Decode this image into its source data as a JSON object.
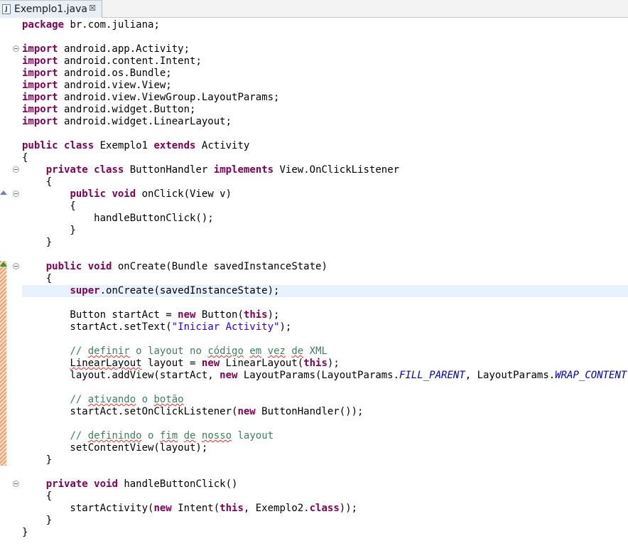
{
  "tab": {
    "title": "Exemplo1.java",
    "close_glyph": "☒",
    "file_icon": "java-file-icon",
    "file_icon_letter": "J"
  },
  "editor": {
    "language": "java",
    "highlighted_line": 23,
    "lines": [
      [
        {
          "t": "package",
          "c": "kw"
        },
        {
          "t": " br.com.juliana;"
        }
      ],
      [],
      [
        {
          "t": "import",
          "c": "kw"
        },
        {
          "t": " android.app.Activity;"
        }
      ],
      [
        {
          "t": "import",
          "c": "kw"
        },
        {
          "t": " android.content.Intent;"
        }
      ],
      [
        {
          "t": "import",
          "c": "kw"
        },
        {
          "t": " android.os.Bundle;"
        }
      ],
      [
        {
          "t": "import",
          "c": "kw"
        },
        {
          "t": " android.view.View;"
        }
      ],
      [
        {
          "t": "import",
          "c": "kw"
        },
        {
          "t": " android.view.ViewGroup.LayoutParams;"
        }
      ],
      [
        {
          "t": "import",
          "c": "kw"
        },
        {
          "t": " android.widget.Button;"
        }
      ],
      [
        {
          "t": "import",
          "c": "kw"
        },
        {
          "t": " android.widget.LinearLayout;"
        }
      ],
      [],
      [
        {
          "t": "public",
          "c": "kw"
        },
        {
          "t": " "
        },
        {
          "t": "class",
          "c": "kw"
        },
        {
          "t": " Exemplo1 "
        },
        {
          "t": "extends",
          "c": "kw"
        },
        {
          "t": " Activity"
        }
      ],
      [
        {
          "t": "{"
        }
      ],
      [
        {
          "t": "    "
        },
        {
          "t": "private",
          "c": "kw"
        },
        {
          "t": " "
        },
        {
          "t": "class",
          "c": "kw"
        },
        {
          "t": " ButtonHandler "
        },
        {
          "t": "implements",
          "c": "kw"
        },
        {
          "t": " View.OnClickListener"
        }
      ],
      [
        {
          "t": "    {"
        }
      ],
      [
        {
          "t": "        "
        },
        {
          "t": "public",
          "c": "kw"
        },
        {
          "t": " "
        },
        {
          "t": "void",
          "c": "kw"
        },
        {
          "t": " onClick(View v)"
        }
      ],
      [
        {
          "t": "        {"
        }
      ],
      [
        {
          "t": "            handleButtonClick();"
        }
      ],
      [
        {
          "t": "        }"
        }
      ],
      [
        {
          "t": "    }"
        }
      ],
      [],
      [
        {
          "t": "    "
        },
        {
          "t": "public",
          "c": "kw"
        },
        {
          "t": " "
        },
        {
          "t": "void",
          "c": "kw"
        },
        {
          "t": " onCreate(Bundle savedInstanceState)"
        }
      ],
      [
        {
          "t": "    {"
        }
      ],
      [
        {
          "t": "        "
        },
        {
          "t": "super",
          "c": "kw"
        },
        {
          "t": ".onCreate(savedInstanceState);"
        }
      ],
      [],
      [
        {
          "t": "        Button startAct = "
        },
        {
          "t": "new",
          "c": "kw"
        },
        {
          "t": " Button("
        },
        {
          "t": "this",
          "c": "kw"
        },
        {
          "t": ");"
        }
      ],
      [
        {
          "t": "        startAct.setText("
        },
        {
          "t": "\"Iniciar Activity\"",
          "c": "str"
        },
        {
          "t": ");"
        }
      ],
      [],
      [
        {
          "t": "        "
        },
        {
          "t": "// ",
          "c": "cm"
        },
        {
          "t": "definir",
          "c": "cm sp"
        },
        {
          "t": " o layout no ",
          "c": "cm"
        },
        {
          "t": "código",
          "c": "cm sp"
        },
        {
          "t": " ",
          "c": "cm"
        },
        {
          "t": "em",
          "c": "cm sp"
        },
        {
          "t": " ",
          "c": "cm"
        },
        {
          "t": "vez",
          "c": "cm sp"
        },
        {
          "t": " ",
          "c": "cm"
        },
        {
          "t": "de",
          "c": "cm sp"
        },
        {
          "t": " XML",
          "c": "cm"
        }
      ],
      [
        {
          "t": "        "
        },
        {
          "t": "LinearLayout",
          "c": "sp"
        },
        {
          "t": " layout = "
        },
        {
          "t": "new",
          "c": "kw"
        },
        {
          "t": " LinearLayout("
        },
        {
          "t": "this",
          "c": "kw"
        },
        {
          "t": ");"
        }
      ],
      [
        {
          "t": "        layout.addView(startAct, "
        },
        {
          "t": "new",
          "c": "kw"
        },
        {
          "t": " LayoutParams(LayoutParams."
        },
        {
          "t": "FILL_PARENT",
          "c": "fld"
        },
        {
          "t": ", LayoutParams."
        },
        {
          "t": "WRAP_CONTENT",
          "c": "fld"
        },
        {
          "t": "));"
        }
      ],
      [],
      [
        {
          "t": "        "
        },
        {
          "t": "// ",
          "c": "cm"
        },
        {
          "t": "ativando",
          "c": "cm sp"
        },
        {
          "t": " o ",
          "c": "cm"
        },
        {
          "t": "botão",
          "c": "cm sp"
        }
      ],
      [
        {
          "t": "        startAct.setOnClickListener("
        },
        {
          "t": "new",
          "c": "kw"
        },
        {
          "t": " ButtonHandler());"
        }
      ],
      [],
      [
        {
          "t": "        "
        },
        {
          "t": "// ",
          "c": "cm"
        },
        {
          "t": "definindo",
          "c": "cm sp"
        },
        {
          "t": " o ",
          "c": "cm"
        },
        {
          "t": "fim",
          "c": "cm sp"
        },
        {
          "t": " ",
          "c": "cm"
        },
        {
          "t": "de",
          "c": "cm sp"
        },
        {
          "t": " ",
          "c": "cm"
        },
        {
          "t": "nosso",
          "c": "cm sp"
        },
        {
          "t": " layout",
          "c": "cm"
        }
      ],
      [
        {
          "t": "        setContentView(layout);"
        }
      ],
      [
        {
          "t": "    }"
        }
      ],
      [],
      [
        {
          "t": "    "
        },
        {
          "t": "private",
          "c": "kw"
        },
        {
          "t": " "
        },
        {
          "t": "void",
          "c": "kw"
        },
        {
          "t": " handleButtonClick()"
        }
      ],
      [
        {
          "t": "    {"
        }
      ],
      [
        {
          "t": "        startActivity("
        },
        {
          "t": "new",
          "c": "kw"
        },
        {
          "t": " Intent("
        },
        {
          "t": "this",
          "c": "kw"
        },
        {
          "t": ", Exemplo2."
        },
        {
          "t": "class",
          "c": "kw"
        },
        {
          "t": "));"
        }
      ],
      [
        {
          "t": "    }"
        }
      ],
      [
        {
          "t": "}"
        }
      ]
    ]
  },
  "gutter": {
    "fold_markers": [
      {
        "line": 2,
        "icon": "fold-collapse-icon"
      },
      {
        "line": 12,
        "icon": "fold-collapse-icon"
      },
      {
        "line": 14,
        "icon": "fold-collapse-icon"
      },
      {
        "line": 20,
        "icon": "fold-collapse-icon"
      },
      {
        "line": 38,
        "icon": "fold-collapse-icon"
      }
    ],
    "override_marker_icon": "override-arrow-icon",
    "implements_marker_icon": "implements-arrow-icon",
    "change_bar_icon": "quick-diff-change-bar"
  },
  "colors": {
    "keyword": "#7f0055",
    "string": "#2a00ff",
    "comment": "#3f7f5f",
    "static_field": "#0000c0",
    "current_line": "#e8f2fe",
    "spell_error": "#e0302b"
  }
}
